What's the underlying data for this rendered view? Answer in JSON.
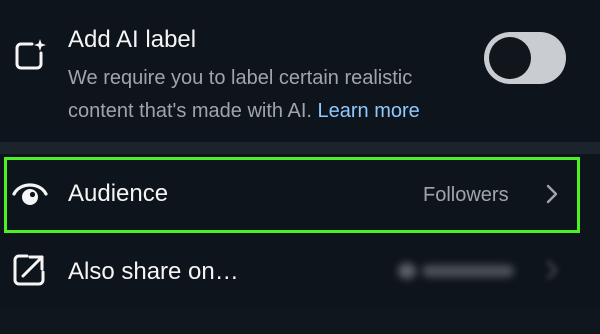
{
  "ai_label": {
    "title": "Add AI label",
    "description": "We require you to label certain realistic content that's made with AI.",
    "link": "Learn more",
    "toggle_on": false
  },
  "audience": {
    "label": "Audience",
    "value": "Followers"
  },
  "share": {
    "label": "Also share on…"
  },
  "icons": {
    "ai": "ai-sparkle-square-icon",
    "audience": "eye-icon",
    "share": "share-arrow-icon",
    "chevron": "chevron-right-icon"
  },
  "colors": {
    "background": "#0e141b",
    "divider": "#1b232c",
    "text_primary": "#f5f5f5",
    "text_secondary": "#a0a5ab",
    "link": "#8ec9ff",
    "highlight": "#4cf026",
    "toggle_track": "#c9ccd0"
  }
}
